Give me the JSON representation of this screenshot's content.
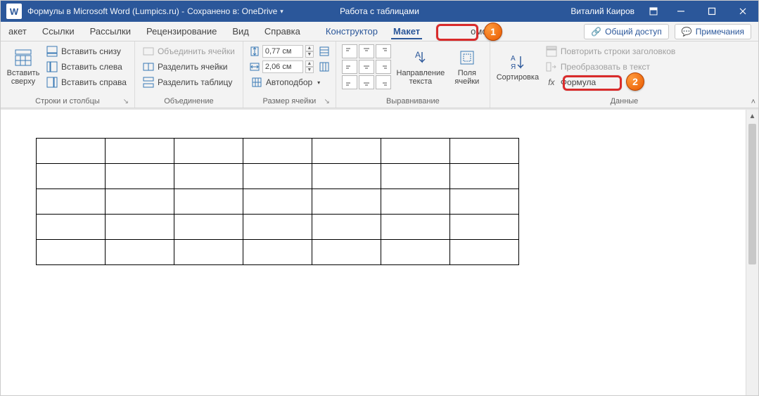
{
  "titlebar": {
    "app_icon_letter": "W",
    "doc_title": "Формулы в Microsoft Word (Lumpics.ru)  -",
    "saved_in": "Сохранено в: OneDrive",
    "context_title": "Работа с таблицами",
    "user_name": "Виталий Каиров"
  },
  "tabs": {
    "maket_partial": "акет",
    "links": "Ссылки",
    "mailings": "Рассылки",
    "review": "Рецензирование",
    "view": "Вид",
    "help": "Справка",
    "constructor": "Конструктор",
    "layout_active": "Макет",
    "help_partial": "омощь",
    "share": "Общий доступ",
    "comments": "Примечания"
  },
  "ribbon": {
    "rows_cols": {
      "insert_above": "Вставить сверху",
      "insert_below": "Вставить снизу",
      "insert_left": "Вставить слева",
      "insert_right": "Вставить справа",
      "group_label": "Строки и столбцы"
    },
    "merge": {
      "merge_cells": "Объединить ячейки",
      "split_cells": "Разделить ячейки",
      "split_table": "Разделить таблицу",
      "group_label": "Объединение"
    },
    "cellsize": {
      "height_val": "0,77 см",
      "width_val": "2,06 см",
      "autofit": "Автоподбор",
      "group_label": "Размер ячейки"
    },
    "alignment": {
      "text_direction": "Направление текста",
      "cell_margins": "Поля ячейки",
      "group_label": "Выравнивание"
    },
    "data": {
      "sort": "Сортировка",
      "repeat_header": "Повторить строки заголовков",
      "convert": "Преобразовать в текст",
      "formula": "Формула",
      "fx_symbol": "fx",
      "group_label": "Данные"
    }
  },
  "callouts": {
    "one": "1",
    "two": "2"
  },
  "table": {
    "rows": 5,
    "cols": 7
  }
}
